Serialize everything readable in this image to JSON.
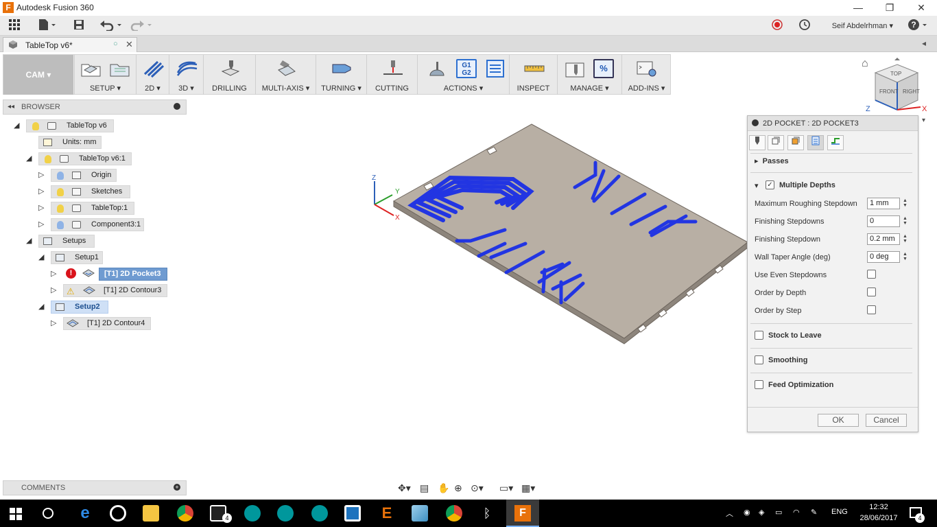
{
  "window": {
    "app_icon_letter": "F",
    "title": "Autodesk Fusion 360"
  },
  "quick_access": {
    "user_name": "Seif Abdelrhman"
  },
  "document_tab": {
    "label": "TableTop v6*"
  },
  "ribbon": {
    "workspace": "CAM",
    "groups": [
      {
        "label": "SETUP"
      },
      {
        "label": "2D"
      },
      {
        "label": "3D"
      },
      {
        "label": "DRILLING"
      },
      {
        "label": "MULTI-AXIS"
      },
      {
        "label": "TURNING"
      },
      {
        "label": "CUTTING"
      },
      {
        "label": "ACTIONS"
      },
      {
        "label": "INSPECT"
      },
      {
        "label": "MANAGE"
      },
      {
        "label": "ADD-INS"
      }
    ],
    "actions_icon_text": "G1\nG2"
  },
  "browser": {
    "header": "BROWSER",
    "nodes": [
      {
        "label": "TableTop v6"
      },
      {
        "label": "Units: mm"
      },
      {
        "label": "TableTop v6:1"
      },
      {
        "label": "Origin"
      },
      {
        "label": "Sketches"
      },
      {
        "label": "TableTop:1"
      },
      {
        "label": "Component3:1"
      },
      {
        "label": "Setups"
      },
      {
        "label": "Setup1"
      },
      {
        "label": "[T1] 2D Pocket3"
      },
      {
        "label": "[T1] 2D Contour3"
      },
      {
        "label": "Setup2"
      },
      {
        "label": "[T1] 2D Contour4"
      }
    ]
  },
  "comments": {
    "header": "COMMENTS"
  },
  "viewcube": {
    "top": "TOP",
    "front": "FRONT",
    "right": "RIGHT",
    "axis_z": "Z",
    "axis_x": "X"
  },
  "triad": {
    "z": "Z",
    "y": "Y",
    "x": "X"
  },
  "dialog": {
    "title": "2D POCKET : 2D POCKET3",
    "sections": {
      "passes": "Passes",
      "multiple_depths": "Multiple Depths",
      "stock_to_leave": "Stock to Leave",
      "smoothing": "Smoothing",
      "feed_optimization": "Feed Optimization"
    },
    "params": [
      {
        "label": "Maximum Roughing Stepdown",
        "value": "1 mm"
      },
      {
        "label": "Finishing Stepdowns",
        "value": "0"
      },
      {
        "label": "Finishing Stepdown",
        "value": "0.2 mm"
      },
      {
        "label": "Wall Taper Angle (deg)",
        "value": "0 deg"
      }
    ],
    "checks": [
      {
        "label": "Use Even Stepdowns"
      },
      {
        "label": "Order by Depth"
      },
      {
        "label": "Order by Step"
      }
    ],
    "ok": "OK",
    "cancel": "Cancel"
  },
  "taskbar": {
    "mail_badge": "4",
    "language": "ENG",
    "time": "12:32",
    "date": "28/06/2017",
    "notification_badge": "4"
  },
  "colors": {
    "toolpath": "#1a2fe6",
    "stock": "#b8afa4",
    "selected": "#6f9bd1"
  }
}
